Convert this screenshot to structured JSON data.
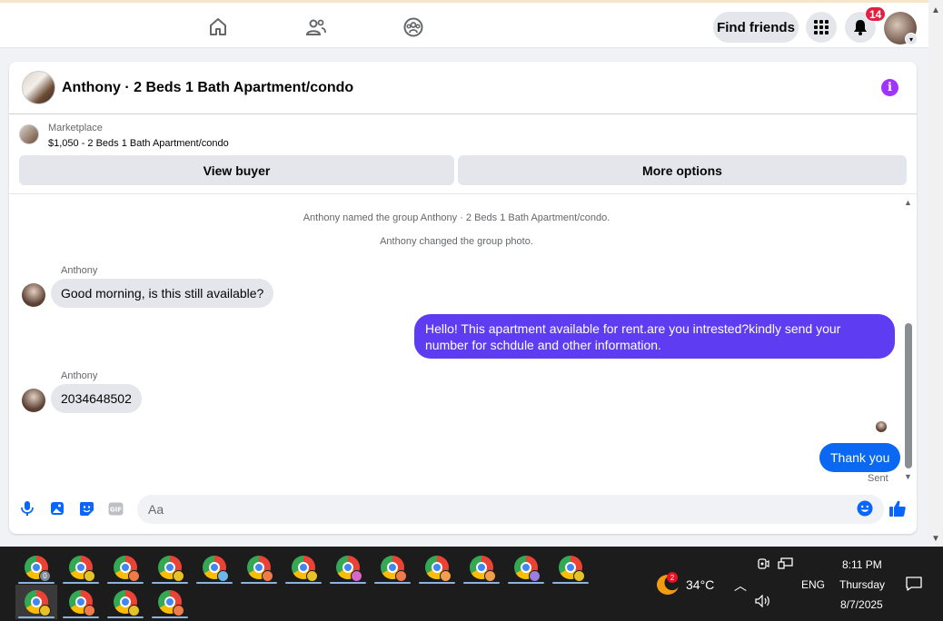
{
  "nav": {
    "find_friends": "Find friends",
    "notifications_count": "14"
  },
  "chat": {
    "title": "Anthony · 2 Beds 1 Bath Apartment/condo",
    "listing_source": "Marketplace",
    "listing_title": "$1,050 - 2 Beds 1 Bath Apartment/condo",
    "view_buyer": "View buyer",
    "more_options": "More options",
    "system_messages": [
      "Anthony named the group Anthony · 2 Beds 1 Bath Apartment/condo.",
      "Anthony changed the group photo."
    ],
    "messages": [
      {
        "sender": "Anthony",
        "text": "Good morning, is this still available?"
      },
      {
        "text": "Hello! This apartment available for rent.are you intrested?kindly send your number for schdule and other information."
      },
      {
        "sender": "Anthony",
        "text": "2034648502"
      },
      {
        "text": "Thank you"
      }
    ],
    "sent_status": "Sent",
    "composer_placeholder": "Aa"
  },
  "colors": {
    "accent_purple": "#5d3cf2",
    "accent_blue": "#0a68f3",
    "info_purple": "#a033ff",
    "messenger_blue": "#0866ff"
  },
  "taskbar": {
    "weather_badge": "2",
    "temperature": "34°C",
    "language": "ENG",
    "time": "8:11 PM",
    "day": "Thursday",
    "date": "8/7/2025",
    "chrome_badge": "0"
  }
}
